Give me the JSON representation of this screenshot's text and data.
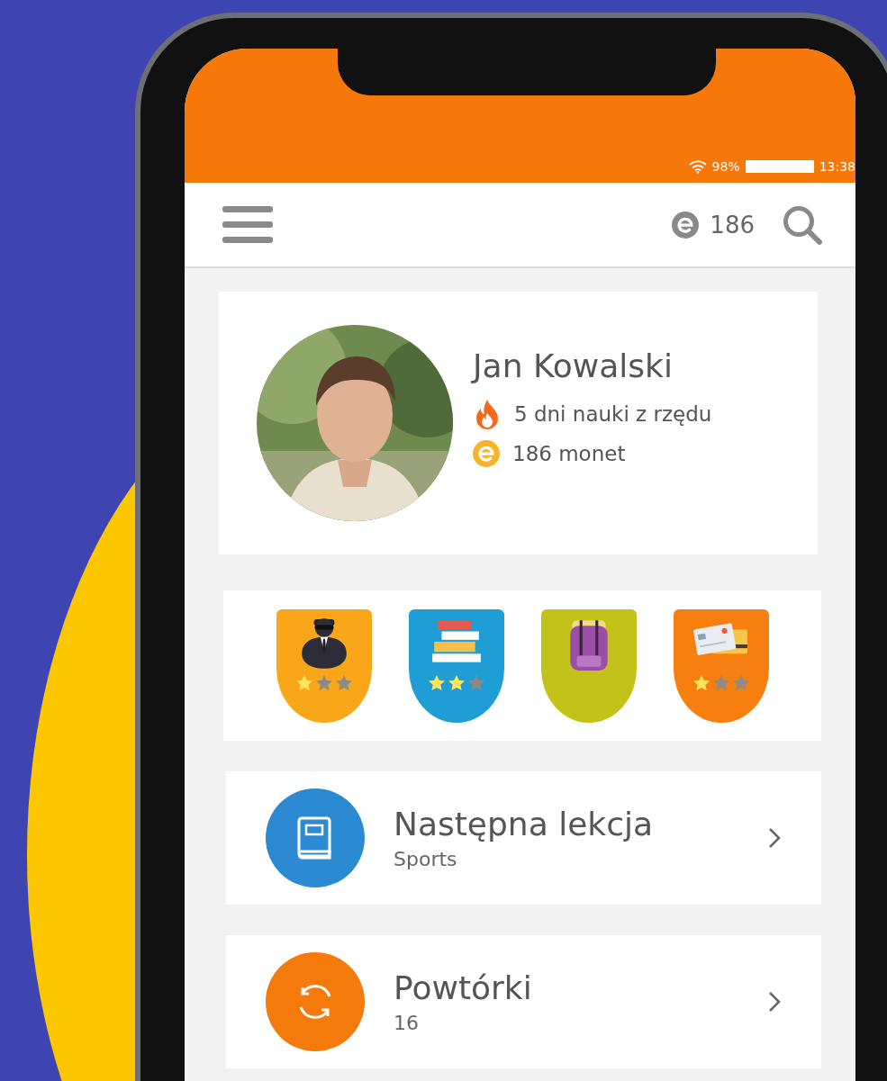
{
  "status_bar": {
    "battery": "98%",
    "time": "13:38"
  },
  "app_bar": {
    "coins": "186"
  },
  "profile": {
    "name": "Jan Kowalski",
    "stats": [
      {
        "kind": "streak",
        "text": "5 dni nauki z rzędu"
      },
      {
        "kind": "coins",
        "text": "186 monet"
      }
    ]
  },
  "badges": [
    {
      "kind": "agent",
      "color": "#f9a619",
      "stars": 1
    },
    {
      "kind": "books",
      "color": "#1e9ed4",
      "stars": 2
    },
    {
      "kind": "backpack",
      "color": "#c3c21a"
    },
    {
      "kind": "cards",
      "color": "#f77f10",
      "stars": 1
    }
  ],
  "cards": [
    {
      "kind": "lesson",
      "title": "Następna lekcja",
      "subtitle": "Sports"
    },
    {
      "kind": "review",
      "title": "Powtórki",
      "subtitle": "16"
    }
  ]
}
